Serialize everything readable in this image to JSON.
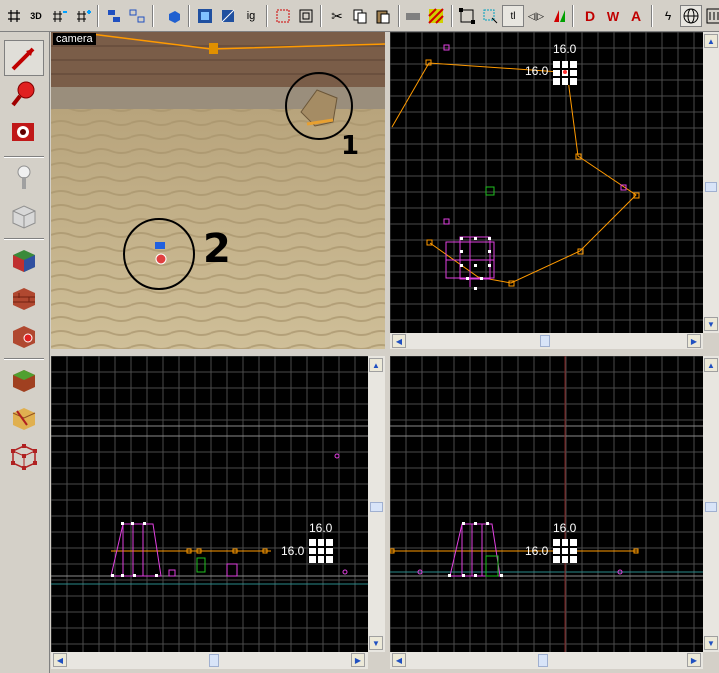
{
  "toolbar": {
    "buttons": [
      {
        "name": "grid-toggle",
        "glyph": "#"
      },
      {
        "name": "3d-grid",
        "glyph": "3D"
      },
      {
        "name": "smaller-grid",
        "glyph": "#-"
      },
      {
        "name": "larger-grid",
        "glyph": "#+"
      },
      {
        "name": "group",
        "glyph": "⧉"
      },
      {
        "name": "ungroup",
        "glyph": "⧈"
      },
      {
        "name": "hide",
        "glyph": "◆"
      },
      {
        "name": "selection-show",
        "glyph": "▣"
      },
      {
        "name": "selection-hide",
        "glyph": "▤"
      },
      {
        "name": "ignore-groups",
        "glyph": "ig"
      },
      {
        "name": "carve",
        "glyph": "◫"
      },
      {
        "name": "make-hollow",
        "glyph": "▢"
      },
      {
        "name": "cut",
        "glyph": "✂"
      },
      {
        "name": "copy",
        "glyph": "⎘"
      },
      {
        "name": "paste",
        "glyph": "📋"
      },
      {
        "name": "cordon",
        "glyph": "▬"
      },
      {
        "name": "texture-lock",
        "glyph": "▨"
      },
      {
        "name": "bounds",
        "glyph": "⬚"
      },
      {
        "name": "select-all",
        "glyph": "⬚"
      },
      {
        "name": "texture-lock-2",
        "glyph": "tl"
      },
      {
        "name": "flip",
        "glyph": "◁▷"
      },
      {
        "name": "flip-vertical",
        "glyph": "▲"
      },
      {
        "name": "draw-d",
        "glyph": "D"
      },
      {
        "name": "draw-w",
        "glyph": "W"
      },
      {
        "name": "draw-a",
        "glyph": "A"
      },
      {
        "name": "toggle-lighting",
        "glyph": "☀"
      },
      {
        "name": "texture-apply",
        "glyph": "◎"
      },
      {
        "name": "texture-browser",
        "glyph": "▦"
      }
    ]
  },
  "viewports": {
    "camera_label": "camera",
    "top_right_label": "16.0",
    "side_label": "16.0",
    "front_label": "16.0",
    "annotation_1": "1",
    "annotation_2": "2"
  },
  "colors": {
    "grid": "#4a4a4a",
    "grid_major": "#6a6a6a",
    "path": "#ff9a00",
    "brush": "#e040e0",
    "selection": "#ffffff",
    "ground": "#c8b48a",
    "wall": "#8b6a4e"
  }
}
